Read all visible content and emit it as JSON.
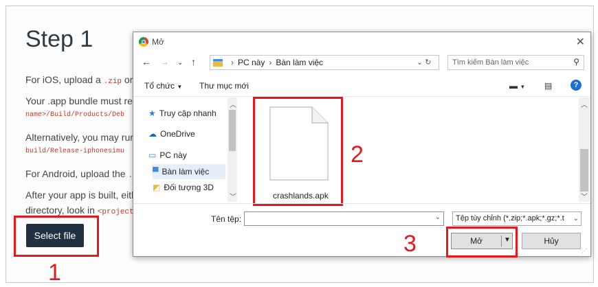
{
  "page": {
    "step_title": "Step 1",
    "ios_text_prefix": "For iOS, upload a ",
    "ios_code": ".zip",
    "ios_text_suffix": " or",
    "bundle_text": "Your .app bundle must re",
    "bundle_code": "name>/Build/Products/Deb",
    "alt_text": "Alternatively, you may rur",
    "alt_code": "build/Release-iphonesimu",
    "android_text_prefix": "For Android, upload the ",
    "android_code": ".",
    "after_text": "After your app is built, eith",
    "directory_text_prefix": "directory, look in ",
    "directory_code": "<project",
    "select_file_label": "Select file"
  },
  "annotations": {
    "n1": "1",
    "n2": "2",
    "n3": "3",
    "color": "#e3191d"
  },
  "dialog": {
    "title": "Mở",
    "breadcrumb": [
      "PC này",
      "Bàn làm việc"
    ],
    "search_placeholder": "Tìm kiếm Bàn làm việc",
    "toolbar": {
      "organize": "Tổ chức",
      "new_folder": "Thư mục mới"
    },
    "nav_items": [
      {
        "label": "Truy cập nhanh",
        "icon": "pin-icon"
      },
      {
        "label": "OneDrive",
        "icon": "cloud-icon"
      },
      {
        "label": "PC này",
        "icon": "computer-icon"
      },
      {
        "label": "Bàn làm việc",
        "icon": "desktop-folder-icon",
        "selected": true
      },
      {
        "label": "Đối tượng 3D",
        "icon": "cube-folder-icon"
      }
    ],
    "file": {
      "name": "crashlands.apk",
      "icon": "generic-file-icon"
    },
    "filename_label": "Tên tệp:",
    "filename_value": "",
    "file_type": "Tệp tùy chỉnh (*.zip;*.apk;*.gz;*.t",
    "open_label": "Mở",
    "cancel_label": "Hủy"
  },
  "colors": {
    "select_button_bg": "#22313f",
    "help_icon": "#1c6fd1",
    "selected_nav_bg": "#e5eef9"
  }
}
